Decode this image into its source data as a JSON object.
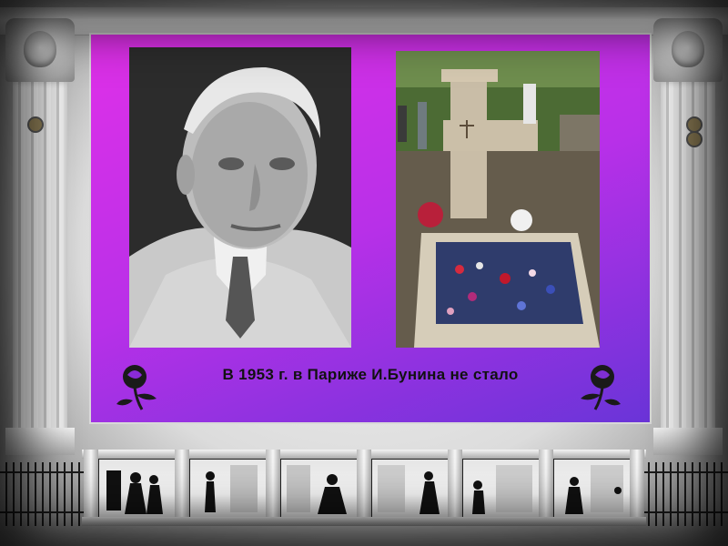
{
  "slide": {
    "caption": "В 1953 г. в Париже И.Бунина не стало"
  },
  "colors": {
    "panel_top": "#e030e8",
    "panel_bottom": "#6a34d8",
    "caption_text": "#111111"
  },
  "icons": {
    "left_ornament": "rose-icon",
    "right_ornament": "rose-icon"
  }
}
